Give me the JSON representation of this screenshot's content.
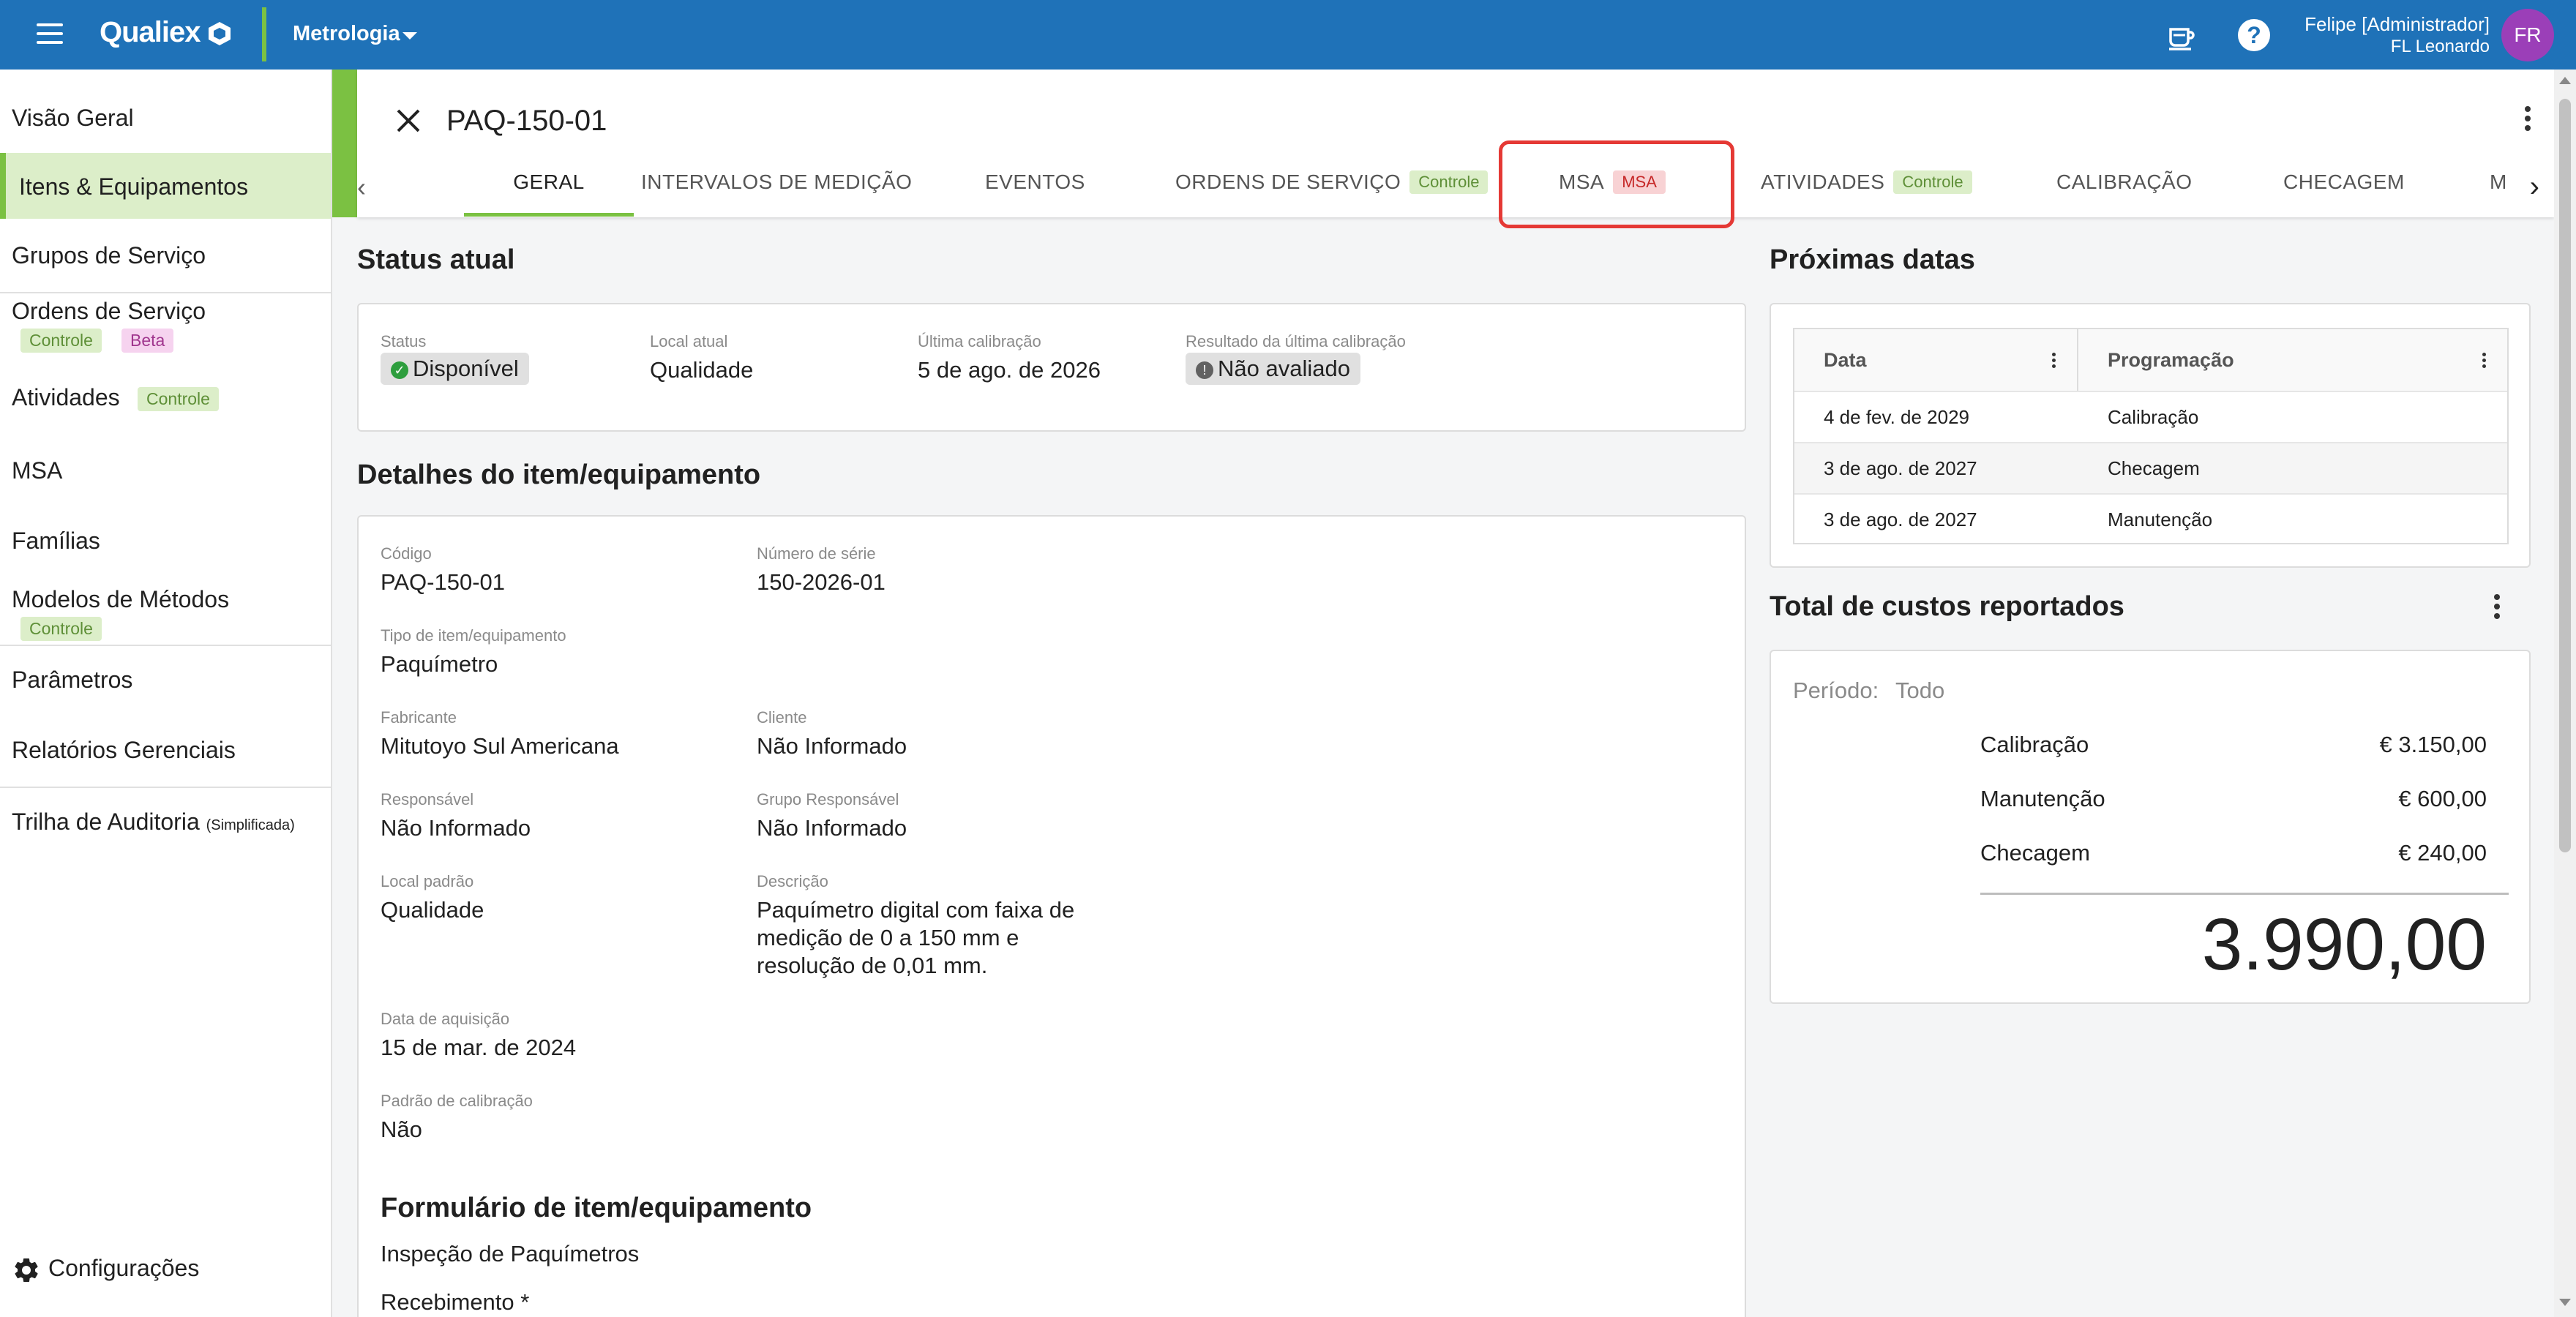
{
  "topbar": {
    "logo": "Qualiex",
    "module": "Metrologia",
    "user_name": "Felipe [Administrador]",
    "user_org": "FL Leonardo",
    "avatar_initials": "FR",
    "brand_color": "#1f72b8",
    "accent_color": "#7bc142"
  },
  "sidebar": {
    "items": [
      {
        "label": "Visão Geral"
      },
      {
        "label": "Itens & Equipamentos",
        "active": true
      },
      {
        "label": "Grupos de Serviço"
      },
      {
        "label": "Ordens de Serviço",
        "chips": [
          "Controle",
          "Beta"
        ]
      },
      {
        "label": "Atividades",
        "chips": [
          "Controle"
        ]
      },
      {
        "label": "MSA"
      },
      {
        "label": "Famílias"
      },
      {
        "label": "Modelos de Métodos",
        "chips": [
          "Controle"
        ]
      },
      {
        "label": "Parâmetros"
      },
      {
        "label": "Relatórios Gerenciais"
      },
      {
        "label": "Trilha de Auditoria",
        "suffix": "(Simplificada)"
      }
    ],
    "config_label": "Configurações"
  },
  "header": {
    "title": "PAQ-150-01",
    "tabs": [
      {
        "label": "GERAL",
        "active": true
      },
      {
        "label": "INTERVALOS DE MEDIÇÃO"
      },
      {
        "label": "EVENTOS"
      },
      {
        "label": "ORDENS DE SERVIÇO",
        "chip": "Controle"
      },
      {
        "label": "MSA",
        "chip": "MSA"
      },
      {
        "label": "ATIVIDADES",
        "chip": "Controle"
      },
      {
        "label": "CALIBRAÇÃO"
      },
      {
        "label": "CHECAGEM"
      },
      {
        "label": "M"
      }
    ]
  },
  "status": {
    "section_title": "Status atual",
    "status_label": "Status",
    "status_value": "Disponível",
    "local_label": "Local atual",
    "local_value": "Qualidade",
    "last_cal_label": "Última calibração",
    "last_cal_value": "5 de ago. de 2026",
    "result_label": "Resultado da última calibração",
    "result_value": "Não avaliado"
  },
  "details": {
    "section_title": "Detalhes do item/equipamento",
    "codigo_label": "Código",
    "codigo_value": "PAQ-150-01",
    "serie_label": "Número de série",
    "serie_value": "150-2026-01",
    "tipo_label": "Tipo de item/equipamento",
    "tipo_value": "Paquímetro",
    "fabricante_label": "Fabricante",
    "fabricante_value": "Mitutoyo Sul Americana",
    "cliente_label": "Cliente",
    "cliente_value": "Não Informado",
    "responsavel_label": "Responsável",
    "responsavel_value": "Não Informado",
    "grupo_label": "Grupo Responsável",
    "grupo_value": "Não Informado",
    "local_padrao_label": "Local padrão",
    "local_padrao_value": "Qualidade",
    "descricao_label": "Descrição",
    "descricao_line1": "Paquímetro digital com faixa de",
    "descricao_line2": "medição de 0 a 150 mm e",
    "descricao_line3": "resolução de 0,01 mm.",
    "aquisicao_label": "Data de aquisição",
    "aquisicao_value": "15 de mar. de 2024",
    "padrao_label": "Padrão de calibração",
    "padrao_value": "Não",
    "form_title": "Formulário de item/equipamento",
    "form_name": "Inspeção de Paquímetros",
    "form_field": "Recebimento *"
  },
  "proximas": {
    "section_title": "Próximas datas",
    "col_data": "Data",
    "col_prog": "Programação",
    "rows": [
      {
        "data": "4 de fev. de 2029",
        "prog": "Calibração"
      },
      {
        "data": "3 de ago. de 2027",
        "prog": "Checagem"
      },
      {
        "data": "3 de ago. de 2027",
        "prog": "Manutenção"
      }
    ]
  },
  "custos": {
    "section_title": "Total de custos reportados",
    "periodo_label": "Período:",
    "periodo_value": "Todo",
    "items": [
      {
        "label": "Calibração",
        "value": "€ 3.150,00"
      },
      {
        "label": "Manutenção",
        "value": "€ 600,00"
      },
      {
        "label": "Checagem",
        "value": "€ 240,00"
      }
    ],
    "total": "3.990,00"
  }
}
